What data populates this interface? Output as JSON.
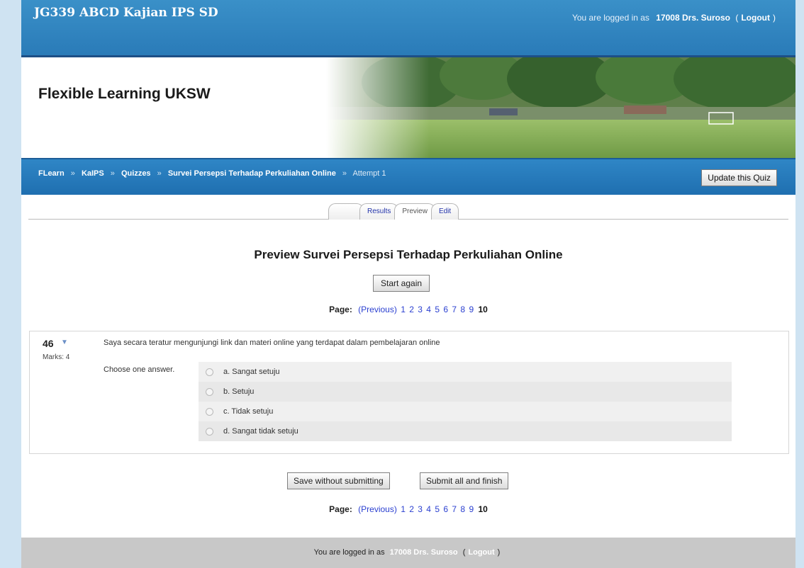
{
  "header": {
    "course_title": "JG339 ABCD Kajian IPS SD",
    "logged_in_prefix": "You are logged in as",
    "user_name": "17008 Drs. Suroso",
    "logout": "Logout"
  },
  "banner": {
    "site_name": "Flexible Learning UKSW"
  },
  "breadcrumb": {
    "items": [
      "FLearn",
      "KaIPS",
      "Quizzes",
      "Survei Persepsi Terhadap Perkuliahan Online"
    ],
    "current": "Attempt 1",
    "separator": "»"
  },
  "update_button": "Update this Quiz",
  "tabs": [
    "",
    "Results",
    "Preview",
    "Edit"
  ],
  "quiz": {
    "title": "Preview Survei Persepsi Terhadap Perkuliahan Online",
    "start_again": "Start again"
  },
  "pager": {
    "label": "Page:",
    "previous": "(Previous)",
    "pages": [
      "1",
      "2",
      "3",
      "4",
      "5",
      "6",
      "7",
      "8",
      "9"
    ],
    "current": "10"
  },
  "question": {
    "number": "46",
    "marks": "Marks: 4",
    "text": "Saya secara teratur mengunjungi link dan materi online yang terdapat dalam pembelajaran online",
    "choose_label": "Choose one answer.",
    "answers": [
      "a. Sangat setuju",
      "b. Setuju",
      "c. Tidak setuju",
      "d. Sangat tidak setuju"
    ]
  },
  "buttons": {
    "save": "Save without submitting",
    "submit": "Submit all and finish"
  },
  "footer": {
    "prefix": "You are logged in as",
    "user_name": "17008 Drs. Suroso",
    "logout": "Logout"
  },
  "colors": {
    "header_blue": "#2a7bb8",
    "link_blue": "#2a3fd0",
    "footer_gray": "#c8c8c8"
  }
}
